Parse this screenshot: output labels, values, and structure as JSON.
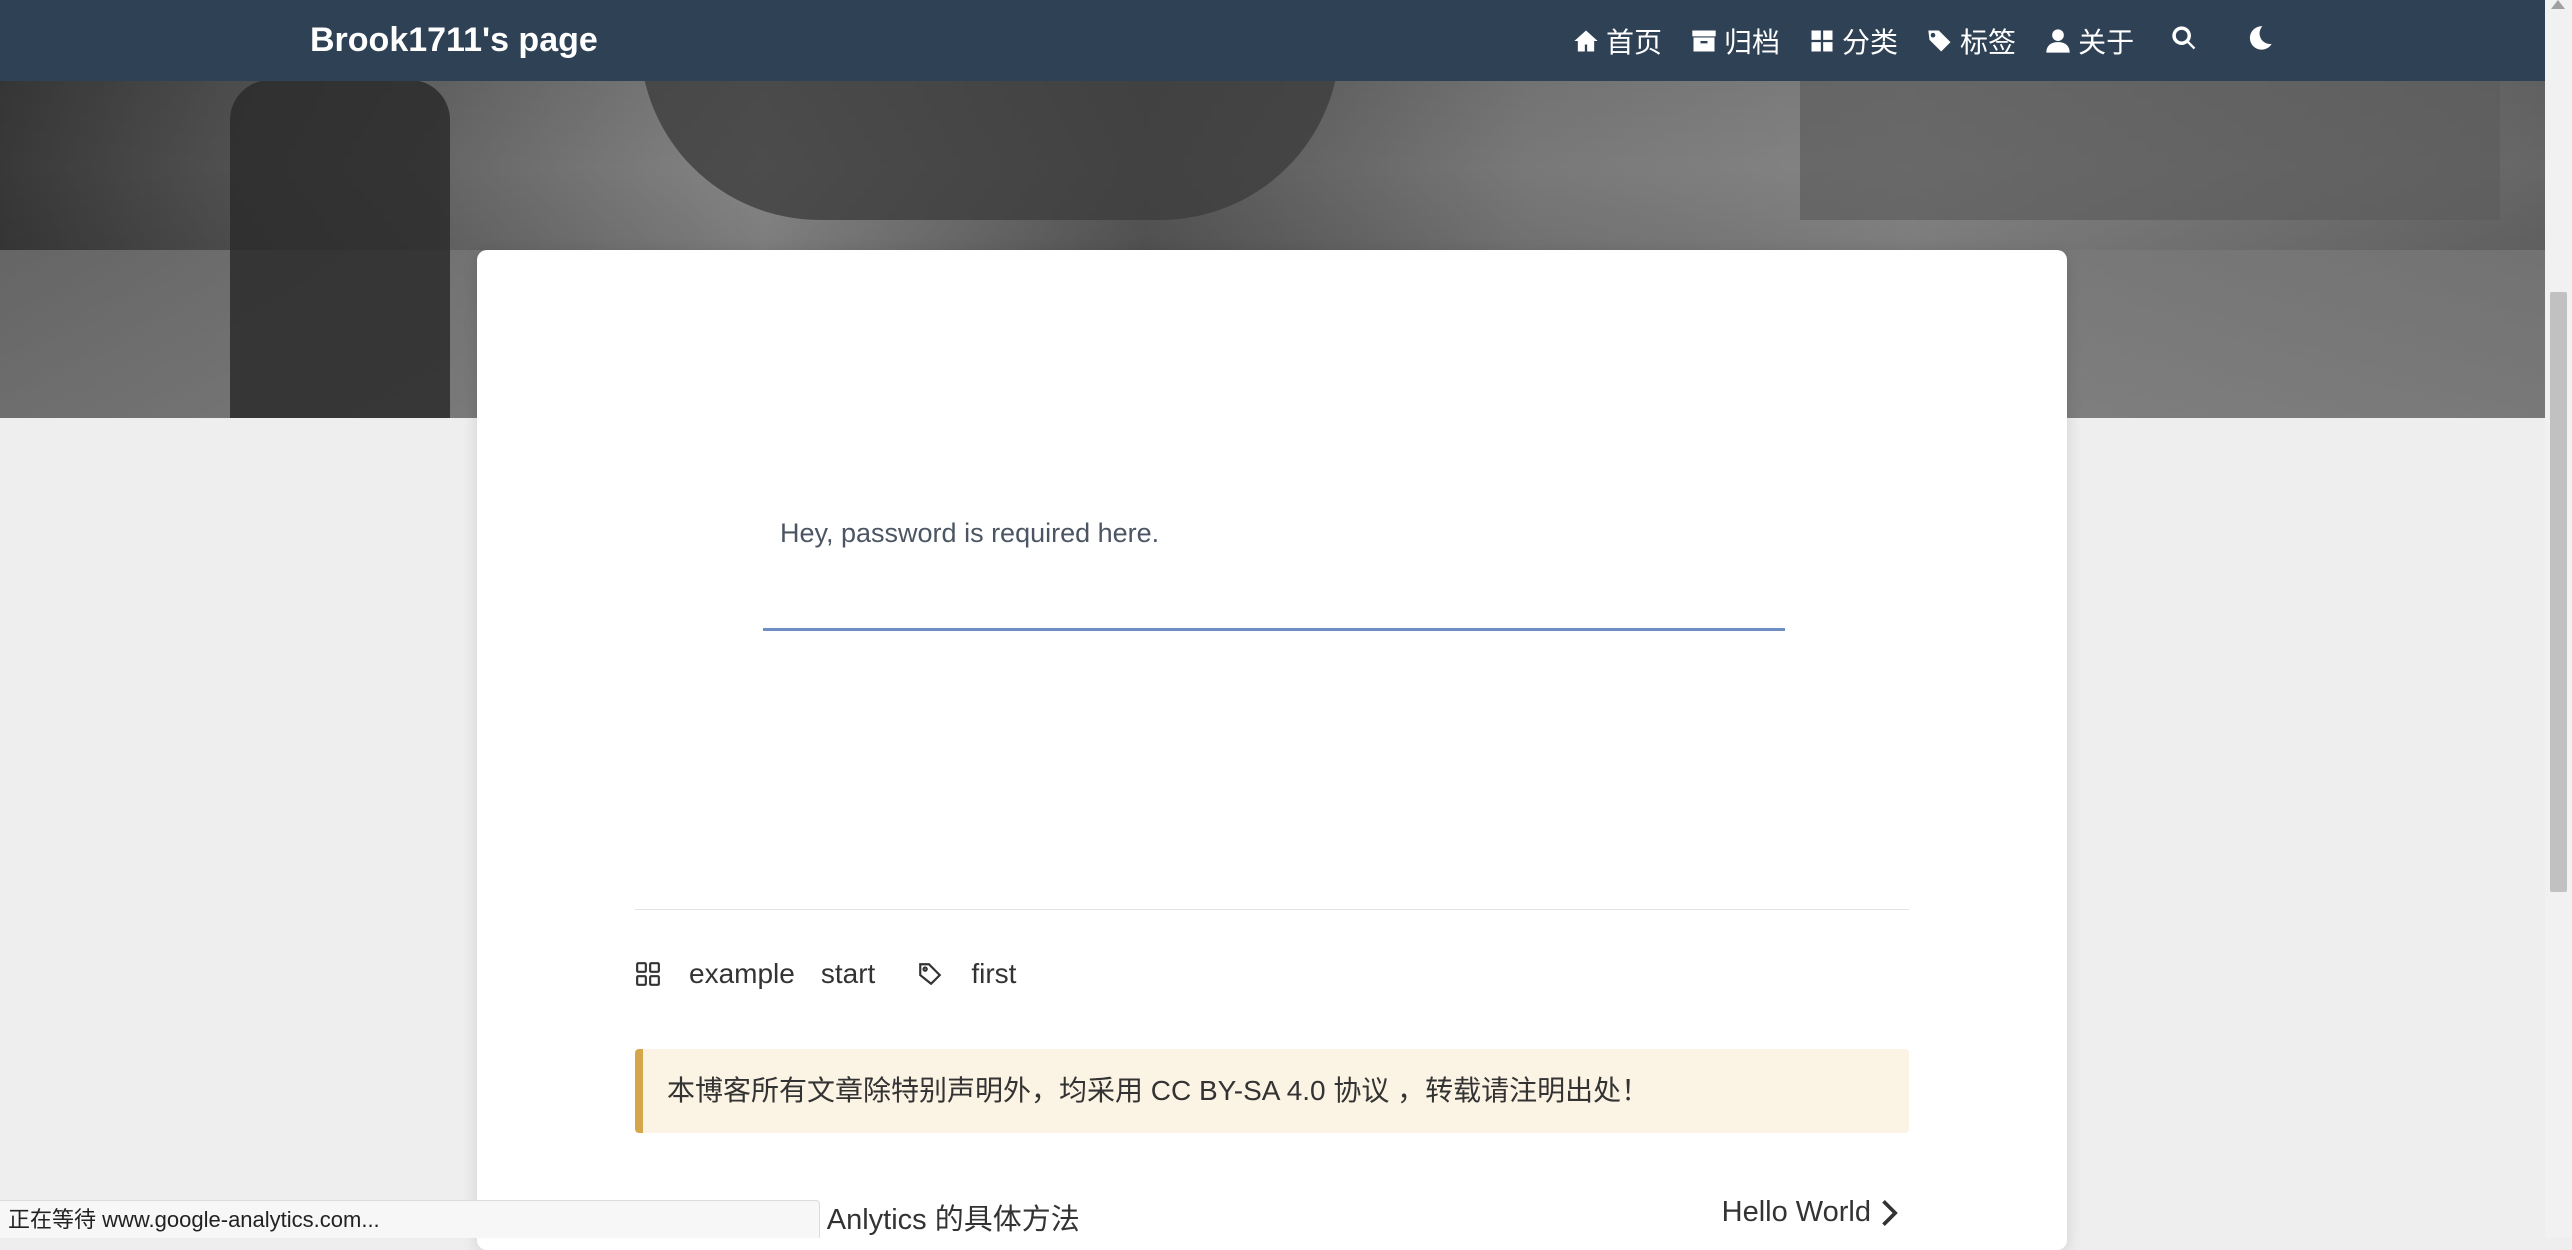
{
  "navbar": {
    "brand": "Brook1711's page",
    "items": [
      {
        "icon": "home-icon",
        "label": "首页"
      },
      {
        "icon": "archive-icon",
        "label": "归档"
      },
      {
        "icon": "grid-icon",
        "label": "分类"
      },
      {
        "icon": "tags-icon",
        "label": "标签"
      },
      {
        "icon": "user-icon",
        "label": "关于"
      }
    ],
    "search_icon": "search-icon",
    "theme_icon": "moon-icon",
    "bg_color": "#2f4154"
  },
  "password": {
    "label": "Hey, password is required here.",
    "value": ""
  },
  "meta": {
    "categories": [
      "example",
      "start"
    ],
    "tags": [
      "first"
    ]
  },
  "notice": {
    "text": "本博客所有文章除特别声明外，均采用 CC BY-SA 4.0 协议 ，转载请注明出处！",
    "accent_color": "#d6a74a",
    "bg_color": "#fbf3e3"
  },
  "post_nav": {
    "prev": "关联 Google Anlytics 的具体方法",
    "next": "Hello World"
  },
  "status_bar": {
    "text": "正在等待 www.google-analytics.com..."
  }
}
